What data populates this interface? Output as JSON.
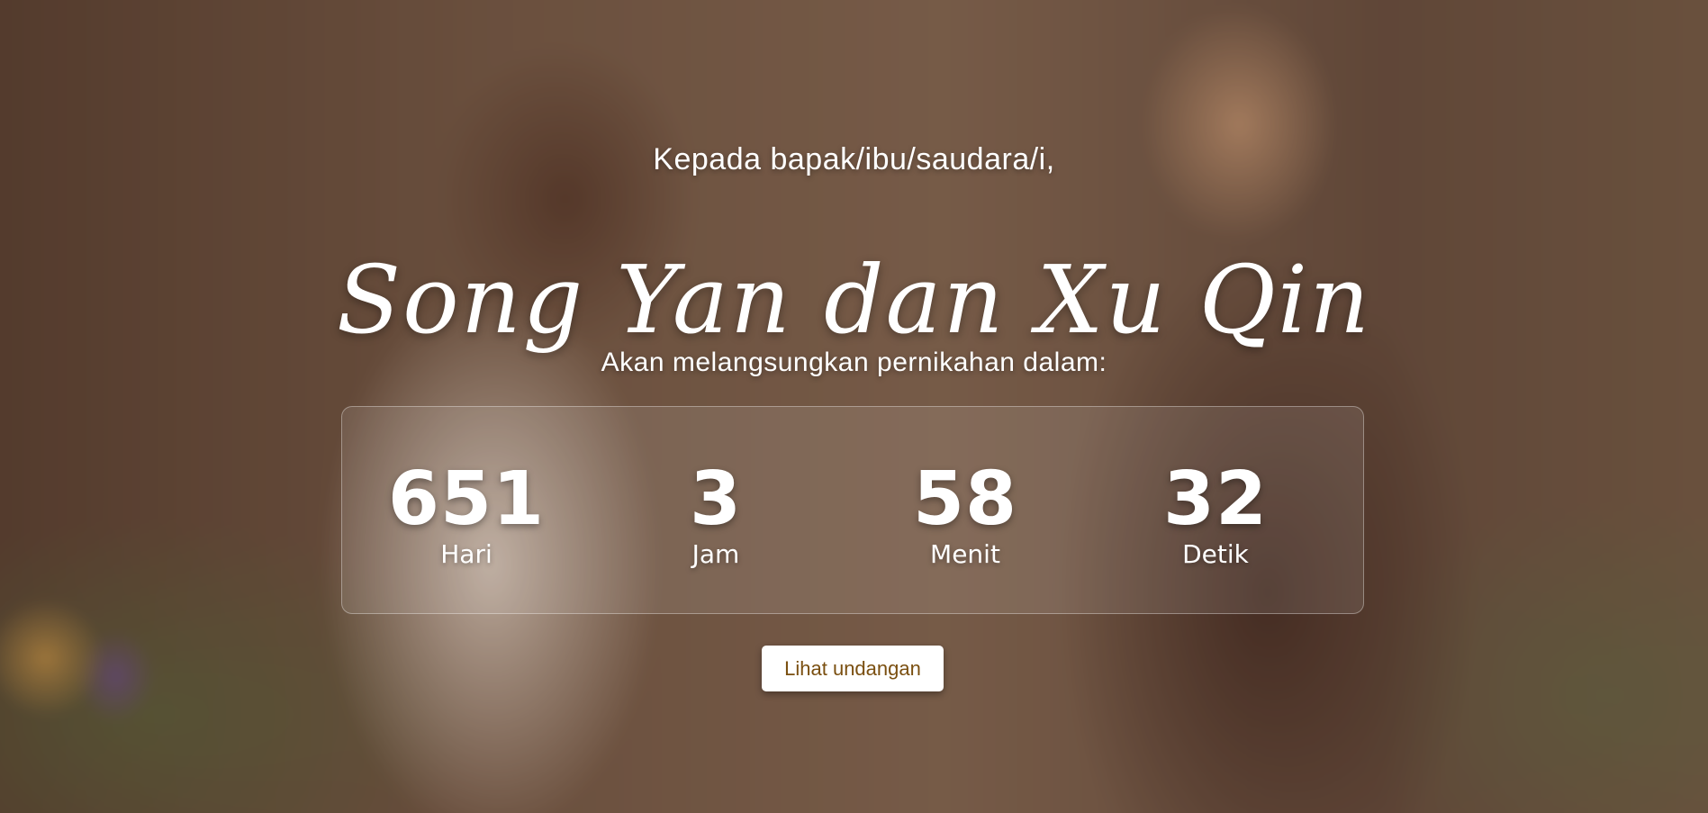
{
  "invitation": {
    "greeting": "Kepada bapak/ibu/saudara/i,",
    "couple_names": "Song Yan dan Xu Qin",
    "subtitle": "Akan melangsungkan pernikahan dalam:"
  },
  "countdown": {
    "units": [
      {
        "value": "651",
        "label": "Hari"
      },
      {
        "value": "3",
        "label": "Jam"
      },
      {
        "value": "58",
        "label": "Menit"
      },
      {
        "value": "32",
        "label": "Detik"
      }
    ]
  },
  "actions": {
    "open_invitation_label": "Lihat undangan"
  },
  "colors": {
    "text": "#ffffff",
    "button_background": "#ffffff",
    "button_text": "#7a4f10"
  }
}
